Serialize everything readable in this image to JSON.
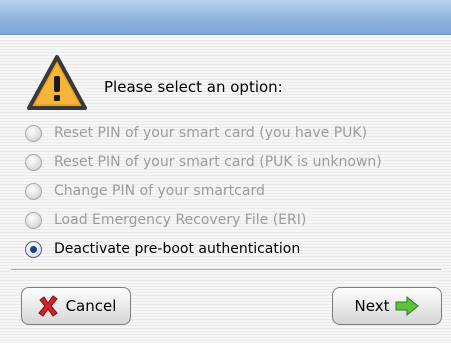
{
  "dialog": {
    "prompt": "Please select an option:",
    "options": [
      {
        "label": "Reset PIN of your smart card (you have PUK)",
        "enabled": false,
        "selected": false
      },
      {
        "label": "Reset PIN of your smart card (PUK is unknown)",
        "enabled": false,
        "selected": false
      },
      {
        "label": "Change PIN of your smartcard",
        "enabled": false,
        "selected": false
      },
      {
        "label": "Load Emergency Recovery File (ERI)",
        "enabled": false,
        "selected": false
      },
      {
        "label": "Deactivate pre-boot authentication",
        "enabled": true,
        "selected": true
      }
    ]
  },
  "buttons": {
    "cancel_label": "Cancel",
    "next_label": "Next"
  },
  "icons": {
    "warning": "warning-icon",
    "cancel": "red-x-icon",
    "next": "green-arrow-right-icon"
  },
  "colors": {
    "disabled_text": "#9c9c9c",
    "radio_selected": "#1e3f83",
    "warning_orange": "#f0a21c",
    "cancel_red": "#d8202a",
    "next_green": "#5ec23a"
  }
}
